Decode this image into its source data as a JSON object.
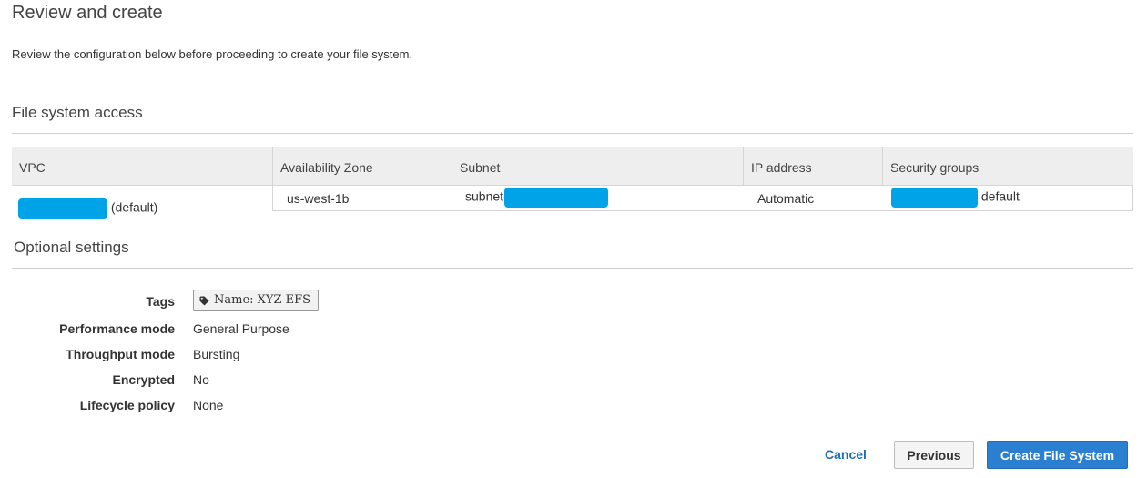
{
  "page": {
    "title": "Review and create",
    "intro": "Review the configuration below before proceeding to create your file system."
  },
  "file_system_access": {
    "title": "File system access",
    "columns": [
      "VPC",
      "Availability Zone",
      "Subnet",
      "IP address",
      "Security groups"
    ],
    "row": {
      "vpc_suffix": "(default)",
      "availability_zone": "us-west-1b",
      "subnet_prefix": "subnet-",
      "ip_address": "Automatic",
      "security_group_suffix": "default"
    },
    "redaction_color": "#00a3e8"
  },
  "optional_settings": {
    "title": "Optional settings",
    "rows": [
      {
        "label": "Tags",
        "value": "Name: XYZ EFS"
      },
      {
        "label": "Performance mode",
        "value": "General Purpose"
      },
      {
        "label": "Throughput mode",
        "value": "Bursting"
      },
      {
        "label": "Encrypted",
        "value": "No"
      },
      {
        "label": "Lifecycle policy",
        "value": "None"
      }
    ],
    "tag_icon": "tag-icon"
  },
  "footer": {
    "cancel_label": "Cancel",
    "previous_label": "Previous",
    "create_label": "Create File System",
    "primary_color": "#2a7fd0",
    "link_color": "#1f6fb5"
  }
}
